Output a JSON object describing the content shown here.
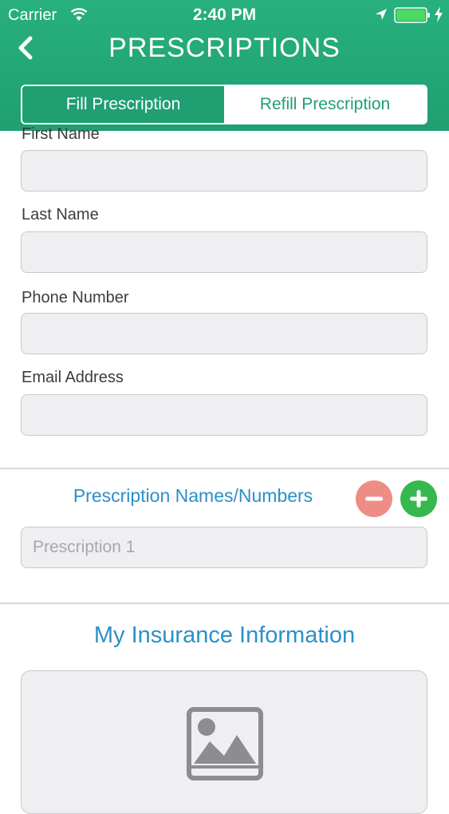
{
  "status_bar": {
    "carrier": "Carrier",
    "time": "2:40 PM",
    "battery_color": "#4cd964"
  },
  "header": {
    "title": "PRESCRIPTIONS",
    "back_icon": "chevron-left-icon"
  },
  "segmented_control": {
    "fill_label": "Fill Prescription",
    "refill_label": "Refill Prescription",
    "selected": "Fill Prescription"
  },
  "form": {
    "fields": [
      {
        "label": "First Name",
        "value": ""
      },
      {
        "label": "Last Name",
        "value": ""
      },
      {
        "label": "Phone Number",
        "value": ""
      },
      {
        "label": "Email Address",
        "value": ""
      }
    ]
  },
  "prescriptions": {
    "title": "Prescription Names/Numbers",
    "remove_icon": "minus-circle-icon",
    "add_icon": "plus-circle-icon",
    "items": [
      {
        "placeholder": "Prescription 1",
        "value": ""
      }
    ]
  },
  "insurance": {
    "title": "My Insurance Information",
    "card_icon": "image-placeholder-icon"
  },
  "colors": {
    "header_green": "#1f9f72",
    "accent_blue": "#2b90c9",
    "remove_red": "#ee8d86",
    "add_green": "#35b84c"
  }
}
